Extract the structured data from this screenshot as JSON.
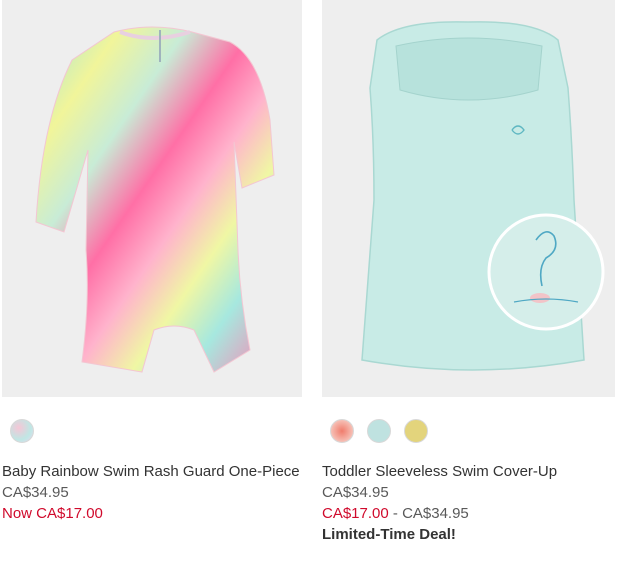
{
  "products": [
    {
      "name": "Baby Rainbow Swim Rash Guard One-Piece",
      "price": "CA$34.95",
      "sale_price": "Now CA$17.00",
      "image_icon": "rainbow-rash-guard-image",
      "swatches": [
        {
          "color": "#cfe6ea",
          "label": "rainbow"
        }
      ]
    },
    {
      "name": "Toddler Sleeveless Swim Cover-Up",
      "price": "CA$34.95",
      "sale_low": "CA$17.00",
      "range_sep": " - ",
      "sale_high": "CA$34.95",
      "deal": "Limited-Time Deal!",
      "image_icon": "mint-cover-up-image",
      "swatches": [
        {
          "color": "#f1a8a0",
          "label": "coral"
        },
        {
          "color": "#bfe2e0",
          "label": "mint"
        },
        {
          "color": "#e3d47c",
          "label": "yellow"
        }
      ]
    }
  ],
  "colors": {
    "sale_red": "#d00a2c",
    "image_bg": "#eeeeee"
  }
}
